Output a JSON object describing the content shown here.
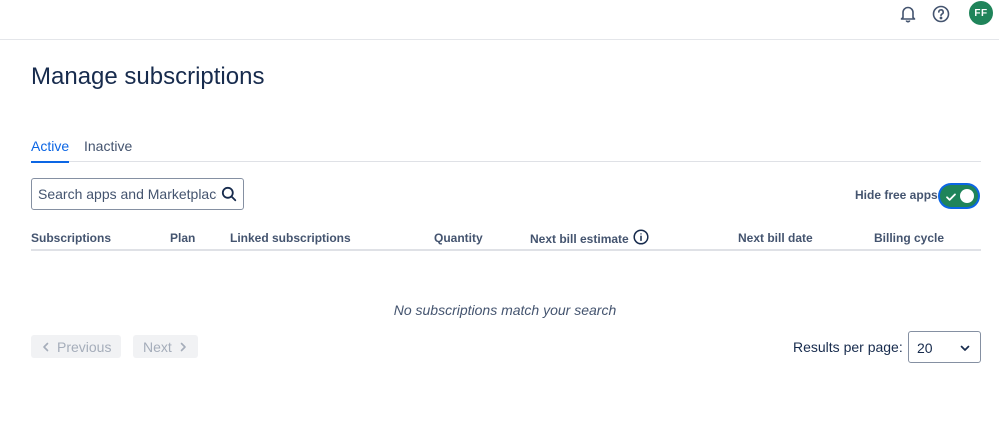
{
  "header": {
    "avatar_initials": "FF",
    "avatar_color": "#1f845a",
    "icons": [
      "bell-icon",
      "help-icon"
    ]
  },
  "page": {
    "title": "Manage subscriptions"
  },
  "tabs": [
    {
      "label": "Active",
      "selected": true
    },
    {
      "label": "Inactive",
      "selected": false
    }
  ],
  "search": {
    "placeholder": "Search apps and Marketplace partners",
    "value": ""
  },
  "filters": {
    "hide_free_apps_label": "Hide free apps",
    "hide_free_apps_on": true
  },
  "table": {
    "columns": [
      "Subscriptions",
      "Plan",
      "Linked subscriptions",
      "Quantity",
      "Next bill estimate",
      "Next bill date",
      "Billing cycle"
    ],
    "rows": [],
    "empty_message": "No subscriptions match your search"
  },
  "pagination": {
    "previous_label": "Previous",
    "next_label": "Next",
    "results_per_page_label": "Results per page:",
    "results_per_page_value": "20"
  },
  "colors": {
    "accent": "#0c66e4",
    "toggle_on": "#1f845a",
    "text": "#172b4d",
    "subtle_text": "#44546f"
  }
}
